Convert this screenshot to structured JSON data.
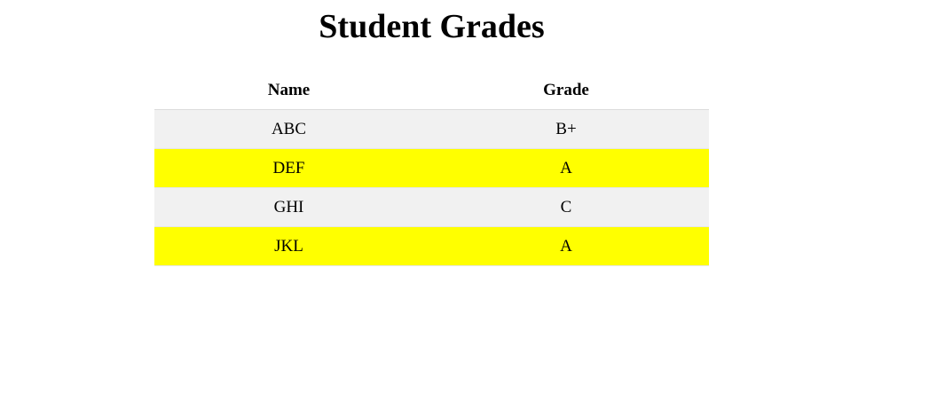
{
  "page": {
    "title": "Student Grades"
  },
  "table": {
    "headers": {
      "name": "Name",
      "grade": "Grade"
    },
    "rows": [
      {
        "name": "ABC",
        "grade": "B+",
        "bg": "#f1f1f1"
      },
      {
        "name": "DEF",
        "grade": "A",
        "bg": "#ffff00"
      },
      {
        "name": "GHI",
        "grade": "C",
        "bg": "#f1f1f1"
      },
      {
        "name": "JKL",
        "grade": "A",
        "bg": "#ffff00"
      }
    ]
  }
}
